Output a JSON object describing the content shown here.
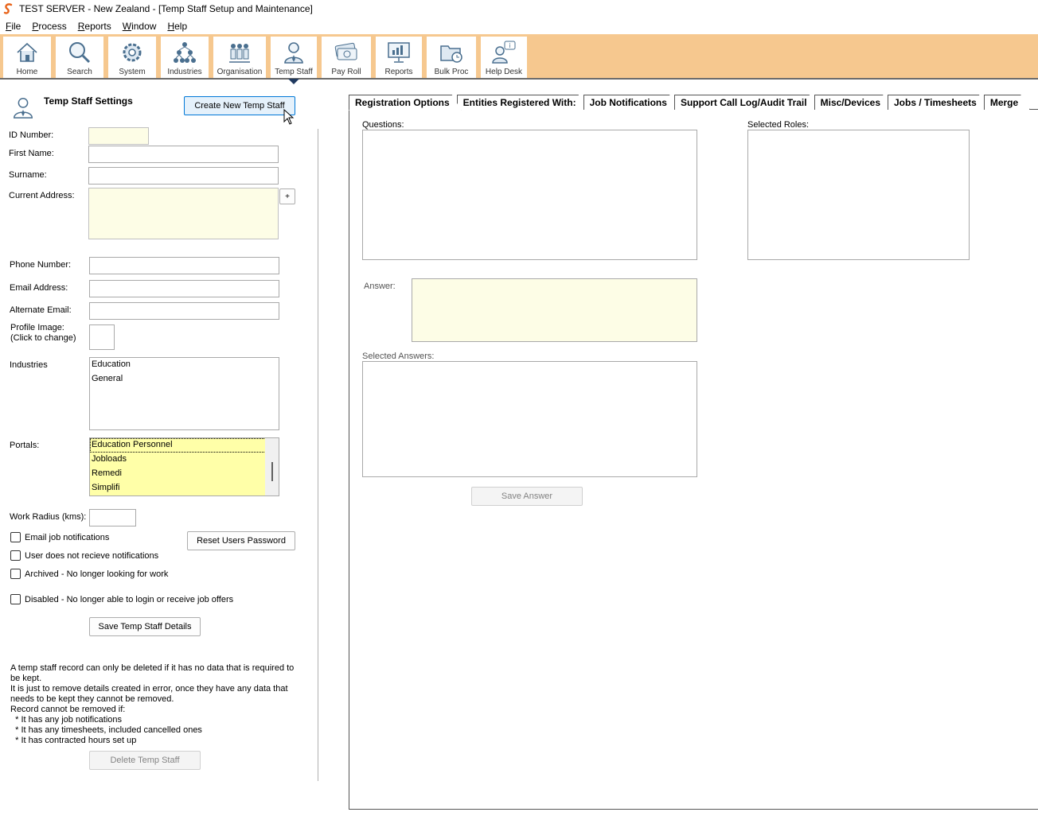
{
  "window": {
    "title": "TEST SERVER - New Zealand - [Temp Staff Setup and Maintenance]"
  },
  "menu": [
    "File",
    "Process",
    "Reports",
    "Window",
    "Help"
  ],
  "toolbar": [
    {
      "label": "Home",
      "icon": "home-icon"
    },
    {
      "label": "Search",
      "icon": "search-icon"
    },
    {
      "label": "System",
      "icon": "gear-icon"
    },
    {
      "label": "Industries",
      "icon": "hierarchy-icon"
    },
    {
      "label": "Organisation",
      "icon": "people-group-icon"
    },
    {
      "label": "Temp Staff",
      "icon": "person-icon"
    },
    {
      "label": "Pay Roll",
      "icon": "money-icon"
    },
    {
      "label": "Reports",
      "icon": "report-chart-icon"
    },
    {
      "label": "Bulk Proc",
      "icon": "folder-clock-icon"
    },
    {
      "label": "Help Desk",
      "icon": "help-desk-icon"
    }
  ],
  "settings": {
    "heading": "Temp Staff Settings",
    "create_button": "Create New Temp Staff",
    "labels": {
      "id_number": "ID Number:",
      "first_name": "First Name:",
      "surname": "Surname:",
      "current_address": "Current Address:",
      "phone_number": "Phone Number:",
      "email_address": "Email Address:",
      "alternate_email": "Alternate Email:",
      "profile_image": "Profile Image:",
      "profile_image_hint": "(Click to change)",
      "industries": "Industries",
      "portals": "Portals:",
      "work_radius": "Work Radius (kms):"
    },
    "values": {
      "id_number": "",
      "first_name": "",
      "surname": "",
      "current_address": "",
      "phone_number": "",
      "email_address": "",
      "alternate_email": "",
      "work_radius": ""
    },
    "add_address_button": "+",
    "industries": [
      "Education",
      "General"
    ],
    "portals": [
      "Education Personnel",
      "Jobloads",
      "Remedi",
      "Simplifi"
    ],
    "checkboxes": {
      "email_job_notifications": "Email job notifications",
      "no_notifications": "User does not recieve notifications",
      "archived": "Archived - No longer looking for work",
      "disabled": "Disabled - No longer able to login or receive job offers"
    },
    "reset_password_button": "Reset Users Password",
    "save_button": "Save Temp Staff Details",
    "delete_info": [
      "A temp staff record can only be deleted if it has no data that is required to be kept.",
      "It is just to remove details created in error, once they have any data that needs to be kept they cannot be removed.",
      "Record cannot be removed if:",
      "  * It has any job notifications",
      "  * It has any timesheets, included cancelled ones",
      "  * It has contracted hours set up"
    ],
    "delete_button": "Delete Temp Staff"
  },
  "tabs": [
    "Registration Options",
    "Entities Registered With:",
    "Job Notifications",
    "Support Call Log/Audit Trail",
    "Misc/Devices",
    "Jobs / Timesheets",
    "Merge"
  ],
  "registration": {
    "questions_label": "Questions:",
    "selected_roles_label": "Selected Roles:",
    "answer_label": "Answer:",
    "answer_value": "",
    "selected_answers_label": "Selected Answers:",
    "save_answer_button": "Save Answer"
  }
}
